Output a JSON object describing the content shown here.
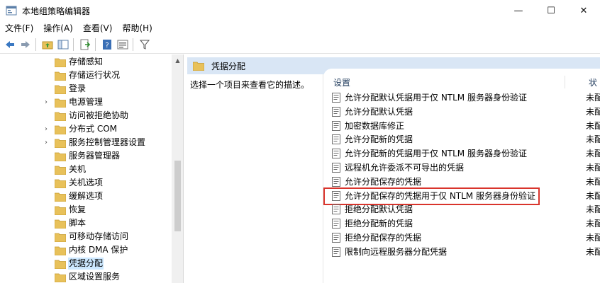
{
  "window": {
    "title": "本地组策略编辑器",
    "minimize": "—",
    "maximize": "☐",
    "close": "✕"
  },
  "menu": [
    "文件(F)",
    "操作(A)",
    "查看(V)",
    "帮助(H)"
  ],
  "toolbar": {
    "buttons": [
      "back-arrow-icon",
      "forward-arrow-icon",
      "up-folder-icon",
      "show-hide-tree-icon",
      "export-list-icon",
      "help-icon",
      "properties-icon",
      "filter-icon"
    ]
  },
  "tree": {
    "items": [
      {
        "label": "存储感知",
        "expander": ""
      },
      {
        "label": "存储运行状况",
        "expander": ""
      },
      {
        "label": "登录",
        "expander": ""
      },
      {
        "label": "电源管理",
        "expander": "›"
      },
      {
        "label": "访问被拒绝协助",
        "expander": ""
      },
      {
        "label": "分布式 COM",
        "expander": "›"
      },
      {
        "label": "服务控制管理器设置",
        "expander": "›"
      },
      {
        "label": "服务器管理器",
        "expander": ""
      },
      {
        "label": "关机",
        "expander": ""
      },
      {
        "label": "关机选项",
        "expander": ""
      },
      {
        "label": "缓解选项",
        "expander": ""
      },
      {
        "label": "恢复",
        "expander": ""
      },
      {
        "label": "脚本",
        "expander": ""
      },
      {
        "label": "可移动存储访问",
        "expander": ""
      },
      {
        "label": "内核 DMA 保护",
        "expander": ""
      },
      {
        "label": "凭据分配",
        "expander": "",
        "selected": true
      },
      {
        "label": "区域设置服务",
        "expander": ""
      }
    ]
  },
  "right": {
    "header": "凭据分配",
    "description": "选择一个项目来查看它的描述。",
    "columns": {
      "setting": "设置",
      "status": "状"
    },
    "rows": [
      {
        "label": "允许分配默认凭据用于仅 NTLM 服务器身份验证",
        "status": "未配"
      },
      {
        "label": "允许分配默认凭据",
        "status": "未配"
      },
      {
        "label": "加密数据库修正",
        "status": "未配"
      },
      {
        "label": "允许分配新的凭据",
        "status": "未配"
      },
      {
        "label": "允许分配新的凭据用于仅 NTLM 服务器身份验证",
        "status": "未配"
      },
      {
        "label": "远程机允许委派不可导出的凭据",
        "status": "未配"
      },
      {
        "label": "允许分配保存的凭据",
        "status": "未配"
      },
      {
        "label": "允许分配保存的凭据用于仅 NTLM 服务器身份验证",
        "status": "未配",
        "highlighted": true
      },
      {
        "label": "拒绝分配默认凭据",
        "status": "未配"
      },
      {
        "label": "拒绝分配新的凭据",
        "status": "未配"
      },
      {
        "label": "拒绝分配保存的凭据",
        "status": "未配"
      },
      {
        "label": "限制向远程服务器分配凭据",
        "status": "未配"
      }
    ]
  },
  "colors": {
    "header_bg": "#d9e6f5",
    "selected_bg": "#cce8ff",
    "highlight_border": "#d9342c",
    "folder": "#e8c15a"
  }
}
